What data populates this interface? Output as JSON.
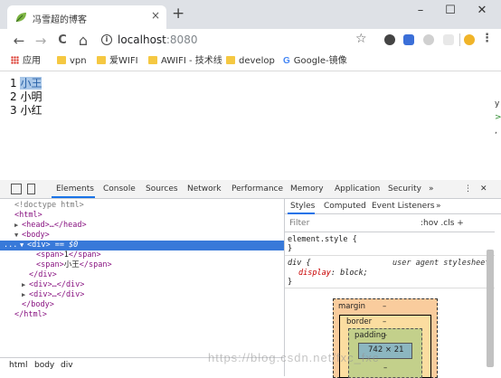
{
  "browser": {
    "tab_title": "冯雪超的博客",
    "tab_close": "×",
    "new_tab": "+",
    "window_controls": {
      "minimize": "–",
      "maximize": "☐",
      "close": "✕"
    },
    "nav": {
      "back": "←",
      "forward": "→",
      "reload": "C",
      "home": "⌂"
    },
    "info_icon": "i",
    "url_host": "localhost",
    "url_port": ":8080",
    "star": "☆",
    "menu": "⋮",
    "bookmarks": [
      {
        "label": "应用",
        "icon": "apps-grid-icon"
      },
      {
        "label": "vpn",
        "icon": "folder-icon"
      },
      {
        "label": "爱WIFI",
        "icon": "folder-icon"
      },
      {
        "label": "AWIFI - 技术线",
        "icon": "folder-icon"
      },
      {
        "label": "develop",
        "icon": "folder-icon"
      },
      {
        "label": "Google-镜像",
        "icon": "google-icon"
      }
    ],
    "google_glyph": "G"
  },
  "page": {
    "rows": [
      {
        "num": "1",
        "name": "小王"
      },
      {
        "num": "2",
        "name": "小明"
      },
      {
        "num": "3",
        "name": "小红"
      }
    ],
    "edge_chars": [
      "y",
      ">",
      ","
    ]
  },
  "devtools": {
    "tabs": [
      "Elements",
      "Console",
      "Sources",
      "Network",
      "Performance",
      "Memory",
      "Application",
      "Security",
      "»"
    ],
    "close": "✕",
    "more": "⋮",
    "dom": {
      "doctype": "<!doctype html>",
      "html_open": "<html>",
      "head": "<head>…</head>",
      "body_open": "<body>",
      "div_open": "<div>",
      "div_marker": " == $0",
      "span1_open": "<span>",
      "span1_text": "1",
      "span1_close": "</span>",
      "span2_open": "<span>",
      "span2_text": "小王",
      "span2_close": "</span>",
      "div_close": "</div>",
      "div2": "<div>…</div>",
      "div3": "<div>…</div>",
      "body_close": "</body>",
      "html_close": "</html>",
      "dots": "..."
    },
    "breadcrumb": [
      "html",
      "body",
      "div"
    ],
    "styles_tabs": [
      "Styles",
      "Computed",
      "Event Listeners",
      "»"
    ],
    "filter_placeholder": "Filter",
    "hov_cls": ":hov  .cls  +",
    "element_style": {
      "selector": "element.style {",
      "close": "}"
    },
    "ua_rule": {
      "selector": "div {",
      "source": "user agent stylesheet",
      "property": "display",
      "value": "block;",
      "close": "}"
    },
    "box_model": {
      "margin": "margin",
      "border": "border",
      "padding": "padding",
      "content": "742 × 21",
      "dash": "–"
    }
  },
  "watermark": "https://blog.csdn.net/fxc_fxc",
  "colors": {
    "selection": "#3879d9",
    "highlight": "#a9c7e8",
    "accent": "#1a73e8"
  }
}
